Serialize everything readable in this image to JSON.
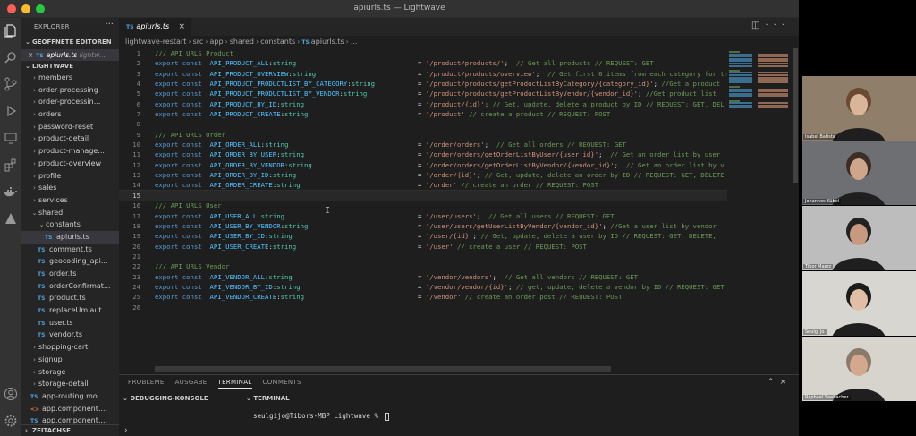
{
  "window": {
    "title": "apiurls.ts — Lightwave"
  },
  "activity_bar": {
    "icons": [
      "files-icon",
      "search-icon",
      "source-control-icon",
      "run-debug-icon",
      "remote-explorer-icon",
      "extensions-icon",
      "docker-icon",
      "deploy-icon",
      "account-icon",
      "settings-gear-icon"
    ]
  },
  "sidebar": {
    "header": "EXPLORER",
    "open_editors_label": "GEÖFFNETE EDITOREN",
    "open_editor": {
      "name": "apiurls.ts",
      "path": "lightw..."
    },
    "project_label": "LIGHTWAVE",
    "tree": [
      {
        "label": "members",
        "kind": "folder"
      },
      {
        "label": "order-processing",
        "kind": "folder"
      },
      {
        "label": "order-processin...",
        "kind": "folder"
      },
      {
        "label": "orders",
        "kind": "folder"
      },
      {
        "label": "password-reset",
        "kind": "folder"
      },
      {
        "label": "product-detail",
        "kind": "folder"
      },
      {
        "label": "product-manage...",
        "kind": "folder"
      },
      {
        "label": "product-overview",
        "kind": "folder"
      },
      {
        "label": "profile",
        "kind": "folder"
      },
      {
        "label": "sales",
        "kind": "folder"
      },
      {
        "label": "services",
        "kind": "folder"
      },
      {
        "label": "shared",
        "kind": "folder-open"
      },
      {
        "label": "constants",
        "kind": "folder-open"
      },
      {
        "label": "apiurls.ts",
        "kind": "ts"
      },
      {
        "label": "comment.ts",
        "kind": "ts"
      },
      {
        "label": "geocoding_api...",
        "kind": "ts"
      },
      {
        "label": "order.ts",
        "kind": "ts"
      },
      {
        "label": "orderConfirmat...",
        "kind": "ts"
      },
      {
        "label": "product.ts",
        "kind": "ts"
      },
      {
        "label": "replaceUmlaut...",
        "kind": "ts"
      },
      {
        "label": "user.ts",
        "kind": "ts"
      },
      {
        "label": "vendor.ts",
        "kind": "ts"
      },
      {
        "label": "shopping-cart",
        "kind": "folder"
      },
      {
        "label": "signup",
        "kind": "folder"
      },
      {
        "label": "storage",
        "kind": "folder"
      },
      {
        "label": "storage-detail",
        "kind": "folder"
      },
      {
        "label": "app-routing.mo...",
        "kind": "ts"
      },
      {
        "label": "app.component....",
        "kind": "html"
      },
      {
        "label": "app.component....",
        "kind": "ts"
      }
    ],
    "timeline_label": "ZEITACHSE"
  },
  "editor": {
    "tab_label": "apiurls.ts",
    "breadcrumb": [
      "lightwave-restart",
      "src",
      "app",
      "shared",
      "constants",
      "apiurls.ts",
      "..."
    ],
    "current_line": 15,
    "lines": [
      {
        "n": "1",
        "type": "comment",
        "text": "/// API URLS Product"
      },
      {
        "n": "2",
        "type": "export",
        "name": "API_PRODUCT_ALL",
        "val": "'/product/products/'",
        "tail": ";",
        "comment": "  // Get all products // REQUEST: GET"
      },
      {
        "n": "3",
        "type": "export",
        "name": "API_PRODUCT_OVERVIEW",
        "val": "'/product/products/overview'",
        "tail": ";",
        "comment": "  // Get first 6 items from each category for the"
      },
      {
        "n": "4",
        "type": "export",
        "name": "API_PRODUCT_PRODUCTLIST_BY_CATEGORY",
        "val": "'/product/products/getProductListByCategory/{category_id}'",
        "tail": ";",
        "comment": " //Get a product"
      },
      {
        "n": "5",
        "type": "export",
        "name": "API_PRODUCT_PRODUCTLIST_BY_VENDOR",
        "val": "'/product/products/getProductListByVendor/{vendor_id}'",
        "tail": ";",
        "comment": " //Get product list"
      },
      {
        "n": "6",
        "type": "export",
        "name": "API_PRODUCT_BY_ID",
        "val": "'/product/{id}'",
        "tail": ";",
        "comment": " // Get, update, delete a product by ID // REQUEST: GET, DEL"
      },
      {
        "n": "7",
        "type": "export",
        "name": "API_PRODUCT_CREATE",
        "val": "'/product'",
        "tail": "",
        "comment": " // create a product // REQUEST: POST"
      },
      {
        "n": "8",
        "type": "blank"
      },
      {
        "n": "9",
        "type": "comment",
        "text": "/// API URLS Order"
      },
      {
        "n": "10",
        "type": "export",
        "name": "API_ORDER_ALL",
        "val": "'/order/orders'",
        "tail": ";",
        "comment": "  // Get all orders // REQUEST: GET"
      },
      {
        "n": "11",
        "type": "export",
        "name": "API_ORDER_BY_USER",
        "val": "'/order/orders/getOrderListByUser/{user_id}'",
        "tail": ";",
        "comment": "  // Get an order list by user"
      },
      {
        "n": "12",
        "type": "export",
        "name": "API_ORDER_BY_VENDOR",
        "val": "'/order/orders/getOrderListByVendor/{vendor_id}'",
        "tail": ";",
        "comment": "  // Get an order list by v"
      },
      {
        "n": "13",
        "type": "export",
        "name": "API_ORDER_BY_ID",
        "val": "'/order/{id}'",
        "tail": ";",
        "comment": " // Get, update, delete an order by ID // REQUEST: GET, DELETE"
      },
      {
        "n": "14",
        "type": "export",
        "name": "API_ORDER_CREATE",
        "val": "'/order'",
        "tail": "",
        "comment": " // create an order // REQUEST: POST"
      },
      {
        "n": "15",
        "type": "blank"
      },
      {
        "n": "16",
        "type": "comment",
        "text": "/// API URLS User"
      },
      {
        "n": "17",
        "type": "export",
        "name": "API_USER_ALL",
        "val": "'/user/users'",
        "tail": ";",
        "comment": "  // Get all users // REQUEST: GET"
      },
      {
        "n": "18",
        "type": "export",
        "name": "API_USER_BY_VENDOR",
        "val": "'/user/users/getUserListByVendor/{vendor_id}'",
        "tail": ";",
        "comment": " //Get a user list by vendor"
      },
      {
        "n": "19",
        "type": "export",
        "name": "API_USER_BY_ID",
        "val": "'/user/{id}'",
        "tail": ";",
        "comment": " // Get, update, delete a user by ID // REQUEST: GET, DELETE,"
      },
      {
        "n": "20",
        "type": "export",
        "name": "API_USER_CREATE",
        "val": "'/user'",
        "tail": "",
        "comment": " // create a user // REQUEST: POST"
      },
      {
        "n": "21",
        "type": "blank"
      },
      {
        "n": "22",
        "type": "comment",
        "text": "/// API URLS Vendor"
      },
      {
        "n": "23",
        "type": "export",
        "name": "API_VENDOR_ALL",
        "val": "'/vendor/vendors'",
        "tail": ";",
        "comment": "  // Get all vendors // REQUEST: GET"
      },
      {
        "n": "24",
        "type": "export",
        "name": "API_VENDOR_BY_ID",
        "val": "'/vendor/vendor/{id}'",
        "tail": ";",
        "comment": " // get, update, delete a vendor by ID // REQUEST: GET"
      },
      {
        "n": "25",
        "type": "export",
        "name": "API_VENDOR_CREATE",
        "val": "'/vendor'",
        "tail": "",
        "comment": " // create an order post // REQUEST: POST"
      },
      {
        "n": "26",
        "type": "blank"
      }
    ],
    "keyword_export": "export",
    "keyword_const": "const",
    "type_name": "string"
  },
  "panel": {
    "tabs": [
      "PROBLEME",
      "AUSGABE",
      "TERMINAL",
      "COMMENTS"
    ],
    "active_tab": "TERMINAL",
    "debug_label": "DEBUGGING-KONSOLE",
    "terminal_label": "TERMINAL",
    "terminal_prompt": "seulgijo@Tibors-MBP Lightwave % "
  },
  "participants": [
    {
      "name": "Isabel Batista",
      "bg": "#8f7f6a",
      "face": "#d9b59a",
      "hair": "#6b4a33"
    },
    {
      "name": "Johannes Kübel",
      "bg": "#6d6f72",
      "face": "#cfa68a",
      "hair": "#3a2e26"
    },
    {
      "name": "Tibor Maerz",
      "bg": "#bdbdbd",
      "face": "#c79a80",
      "hair": "#222222"
    },
    {
      "name": "Seulgi Jo",
      "bg": "#d8d6d0",
      "face": "#e0bfa6",
      "hair": "#1c1c1c"
    },
    {
      "name": "Raphael Seebacher",
      "bg": "#d6d4cc",
      "face": "#d4a88c",
      "hair": "#8a7a6a"
    }
  ],
  "colors": {
    "editor_bg": "#1e1e1e",
    "sidebar_bg": "#252526",
    "activity_bg": "#333333",
    "keyword": "#569cd6",
    "constant": "#4fc1ff",
    "type": "#4ec9b0",
    "string": "#ce9178",
    "comment": "#6a9955"
  }
}
